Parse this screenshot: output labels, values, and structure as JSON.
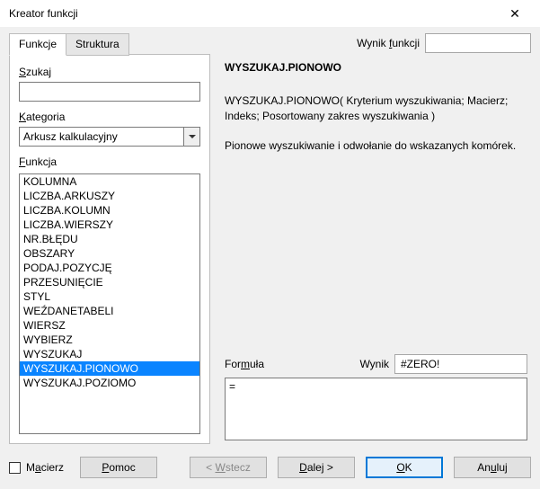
{
  "window": {
    "title": "Kreator funkcji"
  },
  "tabs": {
    "functions": "Funkcje",
    "structure": "Struktura"
  },
  "result_label": "Wynik funkcji",
  "result_label_ul": "f",
  "result_value": "",
  "left": {
    "search_label": "Szukaj",
    "search_value": "",
    "category_label": "Kategoria",
    "category_ul": "K",
    "category_value": "Arkusz kalkulacyjny",
    "function_label": "Funkcja",
    "function_ul": "F",
    "functions": [
      "KOLUMNA",
      "LICZBA.ARKUSZY",
      "LICZBA.KOLUMN",
      "LICZBA.WIERSZY",
      "NR.BŁĘDU",
      "OBSZARY",
      "PODAJ.POZYCJĘ",
      "PRZESUNIĘCIE",
      "STYL",
      "WEŹDANETABELI",
      "WIERSZ",
      "WYBIERZ",
      "WYSZUKAJ",
      "WYSZUKAJ.PIONOWO",
      "WYSZUKAJ.POZIOMO"
    ],
    "selected_index": 13
  },
  "right": {
    "fn_name": "WYSZUKAJ.PIONOWO",
    "fn_sig": "WYSZUKAJ.PIONOWO( Kryterium wyszukiwania; Macierz; Indeks; Posortowany zakres wyszukiwania )",
    "fn_desc": "Pionowe wyszukiwanie i odwołanie do wskazanych komórek.",
    "formula_label": "Formuła",
    "wynik_label": "Wynik",
    "wynik_value": "#ZERO!",
    "formula_value": "="
  },
  "footer": {
    "matrix": "Macierz",
    "matrix_ul": "a",
    "help": "Pomoc",
    "help_ul": "P",
    "back": "< Wstecz",
    "back_ul": "W",
    "next": "Dalej >",
    "next_ul": "D",
    "ok": "OK",
    "ok_ul": "O",
    "cancel": "Anuluj",
    "cancel_ul": "u"
  }
}
